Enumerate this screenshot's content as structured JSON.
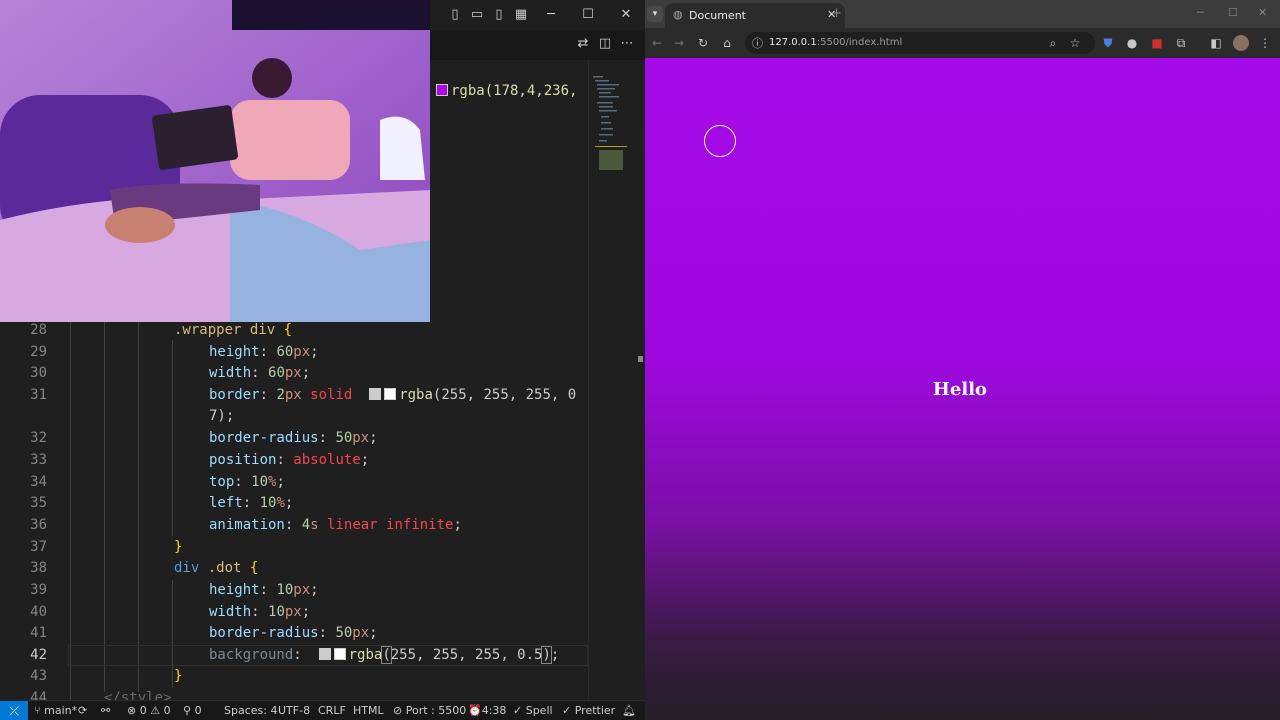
{
  "vscode": {
    "titlebar_icons": [
      "layout-sidebar-left-icon",
      "layout-panel-icon",
      "layout-sidebar-right-icon",
      "customize-layout-icon"
    ],
    "window_controls": {
      "minimize": "─",
      "maximize": "☐",
      "close": "✕"
    },
    "top_code": {
      "swatch_color": "#b204ec",
      "text": "rgba(178,4,236,"
    },
    "lines": [
      {
        "n": "28"
      },
      {
        "n": "29"
      },
      {
        "n": "30"
      },
      {
        "n": "31"
      },
      {
        "n": ""
      },
      {
        "n": "32"
      },
      {
        "n": "33"
      },
      {
        "n": "34"
      },
      {
        "n": "35"
      },
      {
        "n": "36"
      },
      {
        "n": "37"
      },
      {
        "n": "38"
      },
      {
        "n": "39"
      },
      {
        "n": "40"
      },
      {
        "n": "41"
      },
      {
        "n": "42"
      },
      {
        "n": "43"
      },
      {
        "n": "44"
      }
    ],
    "code": {
      "l28_sel": ".wrapper div",
      "l28_brace": "{",
      "l29_prop": "height",
      "l29_num": "60",
      "l29_unit": "px",
      "l30_prop": "width",
      "l30_num": "60",
      "l30_unit": "px",
      "l31_prop": "border",
      "l31_num": "2",
      "l31_unit": "px",
      "l31_kw": "solid",
      "l31_fn": "rgba",
      "l31_args": "(255, 255, 255, 0",
      "l31_wrap": "7);",
      "l32_prop": "border-radius",
      "l32_num": "50",
      "l32_unit": "px",
      "l33_prop": "position",
      "l33_val": "absolute",
      "l34_prop": "top",
      "l34_num": "10",
      "l34_unit": "%",
      "l35_prop": "left",
      "l35_num": "10",
      "l35_unit": "%",
      "l36_prop": "animation",
      "l36_num": "4",
      "l36_unit": "s",
      "l36_val": "linear infinite",
      "l37_brace": "}",
      "l38_sel1": "div",
      "l38_sel2": ".dot",
      "l38_brace": "{",
      "l39_prop": "height",
      "l39_num": "10",
      "l39_unit": "px",
      "l40_prop": "width",
      "l40_num": "10",
      "l40_unit": "px",
      "l41_prop": "border-radius",
      "l41_num": "50",
      "l41_unit": "px",
      "l42_prop": "background",
      "l42_fn": "rgba",
      "l42_args": "255, 255, 255, 0.5",
      "l43_brace": "}",
      "l44_tag": "</style>"
    },
    "statusbar": {
      "branch": "main*",
      "errors": "0",
      "warnings": "0",
      "ports": "0",
      "spaces": "Spaces: 4",
      "encoding": "UTF-8",
      "eol": "CRLF",
      "language": "HTML",
      "port": "Port : 5500",
      "time": "4:38",
      "spell": "Spell",
      "prettier": "Prettier"
    }
  },
  "browser": {
    "tab_title": "Document",
    "url_host": "127.0.0.1",
    "url_rest": ":5500/index.html",
    "page_heading": "Hello"
  }
}
